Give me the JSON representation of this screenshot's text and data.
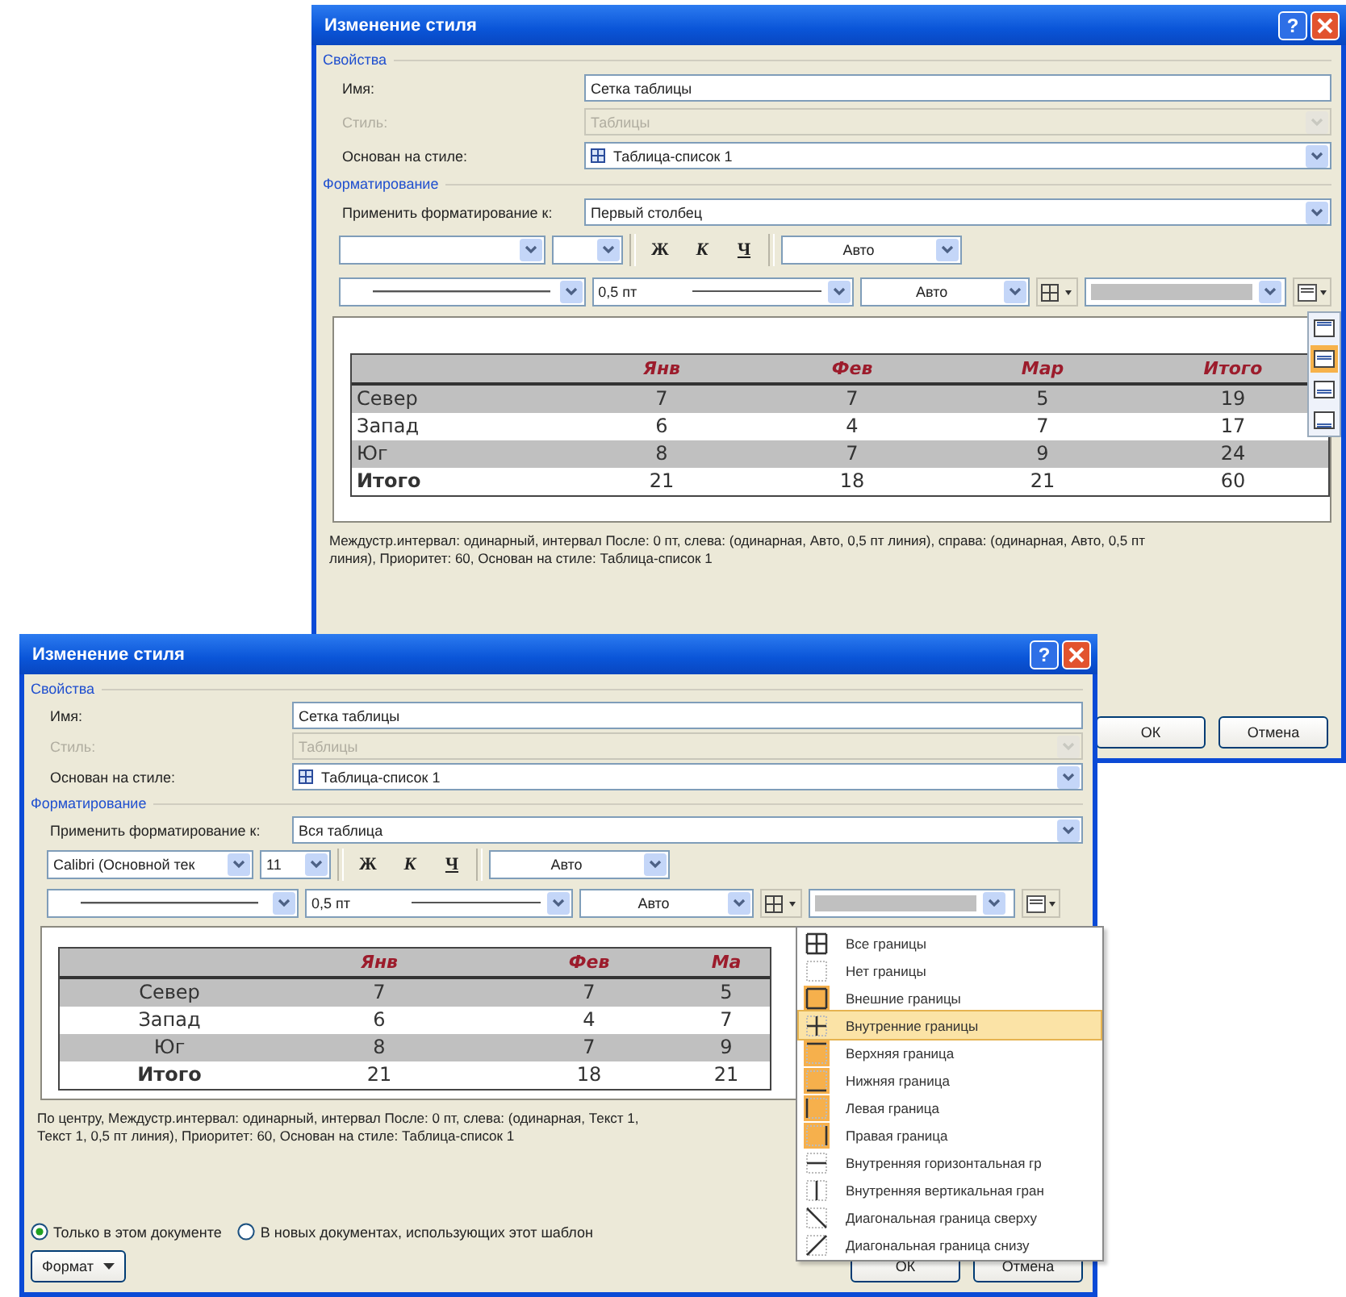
{
  "windows": [
    {
      "title": "Изменение стиля",
      "help": "?",
      "properties": {
        "legend": "Свойства",
        "fields": [
          {
            "label": "Имя:",
            "value": "Сетка таблицы",
            "disabled": false,
            "kind": "text"
          },
          {
            "label": "Стиль:",
            "value": "Таблицы",
            "disabled": true,
            "kind": "combo"
          },
          {
            "label": "Основан на стиле:",
            "value": "Таблица-список 1",
            "disabled": false,
            "kind": "style"
          }
        ]
      },
      "formatting": {
        "legend": "Форматирование",
        "apply_label": "Применить форматирование к:",
        "apply_value": "Первый столбец",
        "bold": "Ж",
        "italic": "К",
        "underline": "Ч",
        "font_color": "Авто",
        "line_width": "0,5 пт",
        "line_color": "Авто"
      },
      "align_menu": [
        {
          "selected": false
        },
        {
          "selected": true
        },
        {
          "selected": false
        },
        {
          "selected": false
        }
      ],
      "preview": {
        "first_column_centered": false,
        "rows": [
          {
            "kind": "header",
            "shaded": true,
            "cells": [
              "",
              "Янв",
              "Фев",
              "Мар",
              "Итого"
            ]
          },
          {
            "kind": "data",
            "shaded": true,
            "cells": [
              "Север",
              "7",
              "7",
              "5",
              "19"
            ]
          },
          {
            "kind": "data",
            "shaded": false,
            "cells": [
              "Запад",
              "6",
              "4",
              "7",
              "17"
            ]
          },
          {
            "kind": "data",
            "shaded": true,
            "cells": [
              "Юг",
              "8",
              "7",
              "9",
              "24"
            ]
          },
          {
            "kind": "total",
            "shaded": false,
            "cells": [
              "Итого",
              "21",
              "18",
              "21",
              "60"
            ]
          }
        ]
      },
      "description": [
        "Междустр.интервал:  одинарный, интервал После:  0 пт, слева: (одинарная, Авто,  0,5 пт линия), справа: (одинарная, Авто,  0,5 пт",
        "линия), Приоритет: 60, Основан на стиле: Таблица-список 1"
      ],
      "buttons": [
        "ОК",
        "Отмена"
      ]
    },
    {
      "title": "Изменение стиля",
      "help": "?",
      "properties": {
        "legend": "Свойства",
        "fields": [
          {
            "label": "Имя:",
            "value": "Сетка таблицы",
            "disabled": false,
            "kind": "text"
          },
          {
            "label": "Стиль:",
            "value": "Таблицы",
            "disabled": true,
            "kind": "combo"
          },
          {
            "label": "Основан на стиле:",
            "value": "Таблица-список 1",
            "disabled": false,
            "kind": "style"
          }
        ]
      },
      "formatting": {
        "legend": "Форматирование",
        "apply_label": "Применить форматирование к:",
        "apply_value": "Вся таблица",
        "font": "Calibri (Основной тек",
        "size": "11",
        "bold": "Ж",
        "italic": "К",
        "underline": "Ч",
        "font_color": "Авто",
        "line_width": "0,5 пт",
        "line_color": "Авто"
      },
      "preview": {
        "first_column_centered": true,
        "rows": [
          {
            "kind": "header",
            "shaded": true,
            "cells": [
              "",
              "Янв",
              "Фев",
              "Ма"
            ]
          },
          {
            "kind": "data",
            "shaded": true,
            "cells": [
              "Север",
              "7",
              "7",
              "5"
            ]
          },
          {
            "kind": "data",
            "shaded": false,
            "cells": [
              "Запад",
              "6",
              "4",
              "7"
            ]
          },
          {
            "kind": "data",
            "shaded": true,
            "cells": [
              "Юг",
              "8",
              "7",
              "9"
            ]
          },
          {
            "kind": "total",
            "shaded": false,
            "cells": [
              "Итого",
              "21",
              "18",
              "21"
            ]
          }
        ]
      },
      "description": [
        "По центру, Междустр.интервал:  одинарный, интервал После:  0 пт, слева: (одинарная, Текст 1,",
        "Текст 1,  0,5 пт линия), Приоритет: 60, Основан на стиле: Таблица-список 1"
      ],
      "radios": [
        {
          "label": "Только в этом документе",
          "selected": true
        },
        {
          "label": "В новых документах, использующих этот шаблон",
          "selected": false
        }
      ],
      "format_button": "Формат",
      "border_menu": [
        {
          "kind": "all",
          "label": "Все границы",
          "checked": false,
          "selected": false
        },
        {
          "kind": "none",
          "label": "Нет границы",
          "checked": false,
          "selected": false
        },
        {
          "kind": "outside",
          "label": "Внешние границы",
          "checked": true,
          "selected": false
        },
        {
          "kind": "inside",
          "label": "Внутренние границы",
          "checked": false,
          "selected": true
        },
        {
          "kind": "top",
          "label": "Верхняя граница",
          "checked": true,
          "selected": false
        },
        {
          "kind": "bottom",
          "label": "Нижняя граница",
          "checked": true,
          "selected": false
        },
        {
          "kind": "left",
          "label": "Левая граница",
          "checked": true,
          "selected": false
        },
        {
          "kind": "right",
          "label": "Правая граница",
          "checked": true,
          "selected": false
        },
        {
          "kind": "inside_h",
          "label": "Внутренняя горизонтальная гр",
          "checked": false,
          "selected": false
        },
        {
          "kind": "inside_v",
          "label": "Внутренняя вертикальная гран",
          "checked": false,
          "selected": false
        },
        {
          "kind": "diag_down",
          "label": "Диагональная граница сверху",
          "checked": false,
          "selected": false
        },
        {
          "kind": "diag_up",
          "label": "Диагональная граница снизу",
          "checked": false,
          "selected": false
        }
      ],
      "buttons": [
        "ОК",
        "Отмена"
      ]
    }
  ]
}
